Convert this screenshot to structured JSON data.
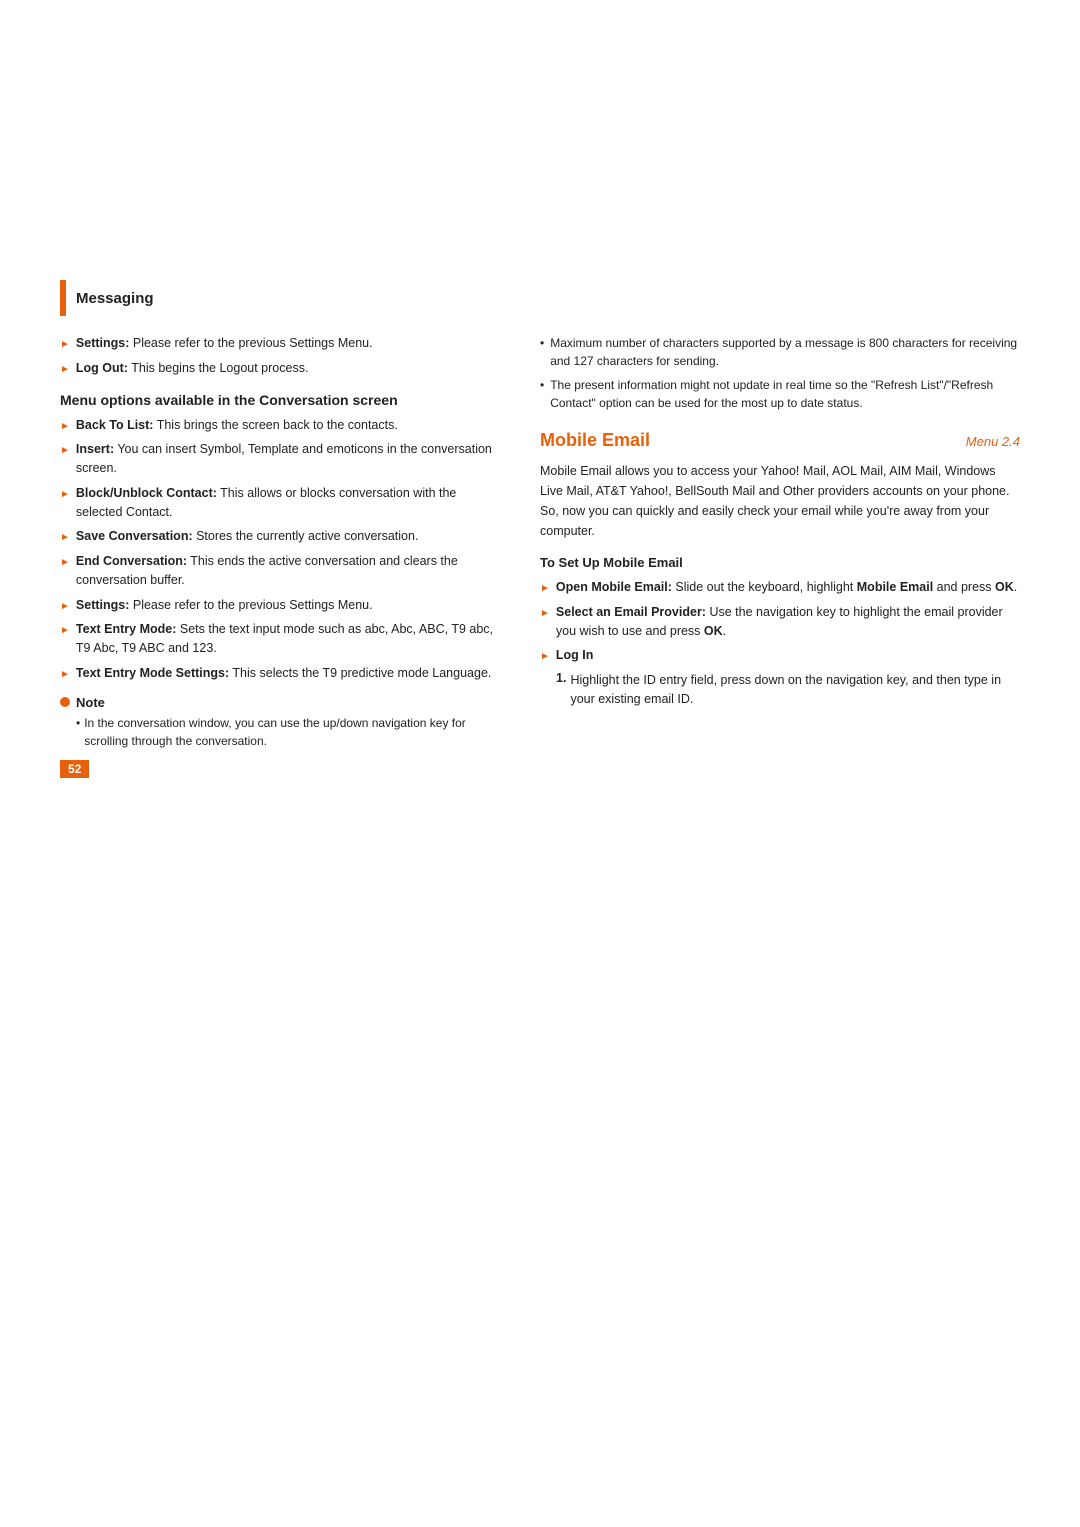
{
  "page": {
    "section": "Messaging",
    "leftColumn": {
      "topItems": [
        {
          "bold": "Settings:",
          "text": " Please refer to the previous Settings Menu."
        },
        {
          "bold": "Log Out:",
          "text": " This begins the Logout process."
        }
      ],
      "subsectionHeading": "Menu options available in the Conversation screen",
      "bulletItems": [
        {
          "bold": "Back To List:",
          "text": " This brings the screen back to the contacts."
        },
        {
          "bold": "Insert:",
          "text": " You can insert Symbol, Template and emoticons in the conversation screen."
        },
        {
          "bold": "Block/Unblock Contact:",
          "text": " This allows or blocks conversation with the selected Contact."
        },
        {
          "bold": "Save Conversation:",
          "text": " Stores the currently active conversation."
        },
        {
          "bold": "End Conversation:",
          "text": " This ends the active conversation and clears the conversation buffer."
        },
        {
          "bold": "Settings:",
          "text": " Please refer to the previous Settings Menu."
        },
        {
          "bold": "Text Entry Mode:",
          "text": " Sets the text input mode such as abc, Abc, ABC, T9 abc, T9 Abc, T9 ABC and 123."
        },
        {
          "bold": "Text Entry Mode Settings:",
          "text": " This selects the T9 predictive mode Language."
        }
      ],
      "note": {
        "title": "Note",
        "items": [
          "In the conversation window, you can use the up/down navigation key for scrolling through the conversation."
        ]
      },
      "pageNumber": "52"
    },
    "rightColumn": {
      "topNotes": [
        "Maximum number of characters supported by a message is 800 characters for receiving and 127 characters for sending.",
        "The present information might not update in real time so the \"Refresh List\"/\"Refresh Contact\" option can be used for the most up to date status."
      ],
      "mobileEmail": {
        "title": "Mobile Email",
        "menuLabel": "Menu 2.4",
        "description": "Mobile Email allows you to access your Yahoo! Mail, AOL Mail, AIM Mail, Windows Live Mail, AT&T Yahoo!, BellSouth Mail and Other providers accounts on your phone. So, now you can quickly and easily check your email while you're away from your computer.",
        "setupHeading": "To Set Up Mobile Email",
        "setupItems": [
          {
            "bold": "Open Mobile Email:",
            "text": " Slide out the keyboard, highlight ",
            "boldEnd": "Mobile Email",
            "textEnd": " and press ",
            "boldFinal": "OK",
            "textFinal": "."
          },
          {
            "bold": "Select an Email Provider:",
            "text": " Use the navigation key to highlight the email provider you wish to use and press ",
            "boldEnd": "OK",
            "textEnd": "."
          }
        ],
        "logIn": {
          "label": "Log In",
          "steps": [
            {
              "number": "1.",
              "text": "Highlight the ID entry field, press down on the navigation key, and then type in your existing email ID."
            }
          ]
        }
      }
    }
  }
}
